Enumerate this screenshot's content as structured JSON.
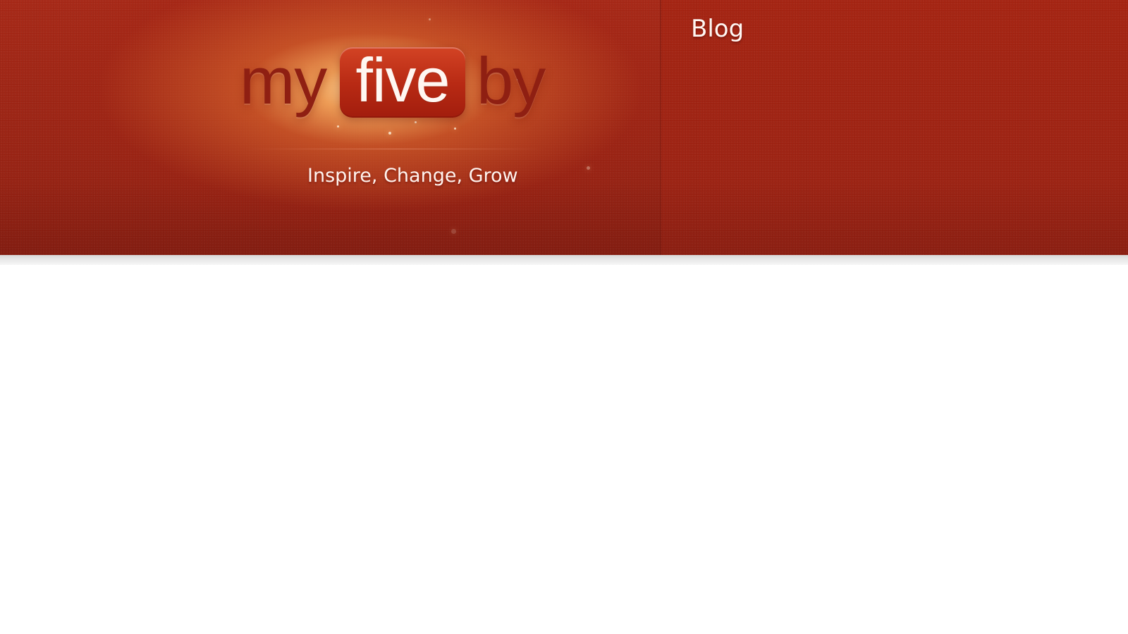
{
  "brand": {
    "logo_left": "my",
    "logo_center": "five",
    "logo_right": "by",
    "tagline": "Inspire, Change, Grow"
  },
  "navigation": {
    "blog_label": "Blog"
  },
  "colors": {
    "header_red": "#a52311",
    "logo_badge_red": "#b82a14",
    "text_light": "#fff7f3"
  }
}
